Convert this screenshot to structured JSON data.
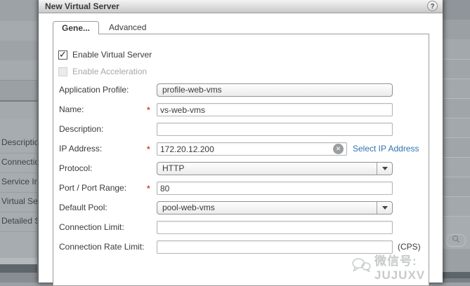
{
  "window": {
    "title": "New Virtual Server",
    "help_label": "?"
  },
  "tabs": {
    "general": "Gene...",
    "advanced": "Advanced"
  },
  "form": {
    "required_marker": "*",
    "enable_virtual_server": {
      "label": "Enable Virtual Server",
      "checked": true
    },
    "enable_acceleration": {
      "label": "Enable Acceleration",
      "checked": false
    },
    "fields": [
      {
        "label": "Application Profile:",
        "value": "profile-web-vms",
        "required": false
      },
      {
        "label": "Name:",
        "value": "vs-web-vms",
        "required": true
      },
      {
        "label": "Description:",
        "value": "",
        "required": false
      },
      {
        "label": "IP Address:",
        "value": "172.20.12.200",
        "required": true,
        "link": "Select IP Address"
      },
      {
        "label": "Protocol:",
        "value": "HTTP",
        "required": false
      },
      {
        "label": "Port / Port Range:",
        "value": "80",
        "required": true
      },
      {
        "label": "Default Pool:",
        "value": "pool-web-vms",
        "required": false
      },
      {
        "label": "Connection Limit:",
        "value": "",
        "required": false
      },
      {
        "label": "Connection Rate Limit:",
        "value": "",
        "required": false,
        "suffix": "(CPS)"
      }
    ]
  },
  "background_panel": {
    "labels": [
      "Description",
      "Connection",
      "Service Ins",
      "Virtual Ser",
      "Detailed St"
    ]
  },
  "watermark": {
    "text": "微信号: JUJUXV"
  },
  "colors": {
    "link": "#3173b0",
    "required": "#cf4a40",
    "dialog_bg": "#ffffff",
    "overlay_bg": "#9aa0a4"
  }
}
